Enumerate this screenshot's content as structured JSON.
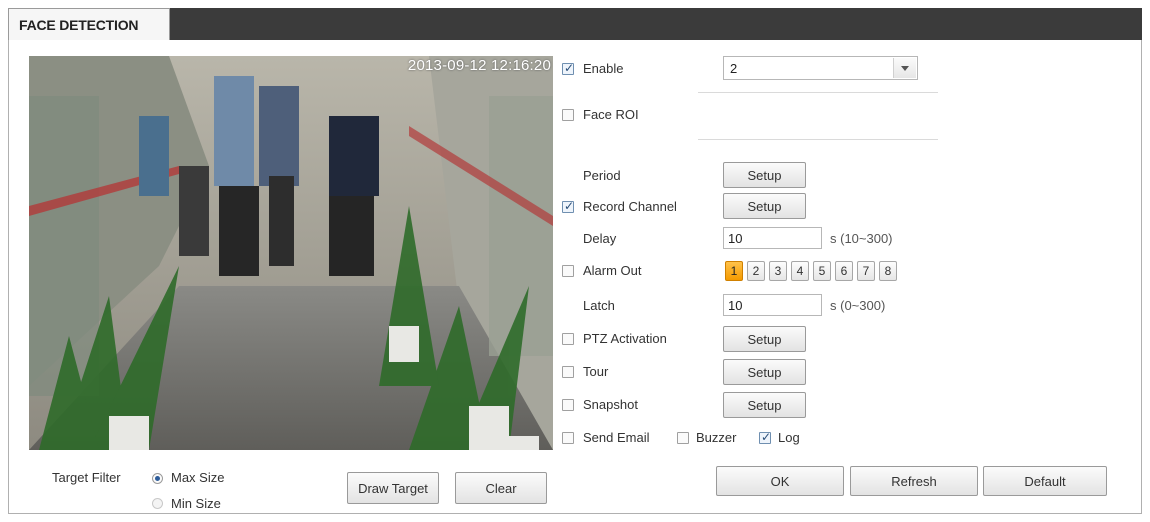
{
  "tab": {
    "title": "FACE DETECTION"
  },
  "video": {
    "timestamp": "2013-09-12 12:16:20"
  },
  "settings": {
    "enable": {
      "label": "Enable",
      "checked": true
    },
    "channel_select": {
      "value": "2"
    },
    "face_roi": {
      "label": "Face ROI",
      "checked": false
    },
    "period": {
      "label": "Period",
      "button": "Setup"
    },
    "record_channel": {
      "label": "Record Channel",
      "checked": true,
      "button": "Setup"
    },
    "delay": {
      "label": "Delay",
      "value": "10",
      "unit": "s (10~300)"
    },
    "alarm_out": {
      "label": "Alarm Out",
      "checked": false,
      "channels": [
        "1",
        "2",
        "3",
        "4",
        "5",
        "6",
        "7",
        "8"
      ],
      "active": "1"
    },
    "latch": {
      "label": "Latch",
      "value": "10",
      "unit": "s (0~300)"
    },
    "ptz_activation": {
      "label": "PTZ Activation",
      "checked": false,
      "button": "Setup"
    },
    "tour": {
      "label": "Tour",
      "checked": false,
      "button": "Setup"
    },
    "snapshot": {
      "label": "Snapshot",
      "checked": false,
      "button": "Setup"
    },
    "send_email": {
      "label": "Send Email",
      "checked": false
    },
    "buzzer": {
      "label": "Buzzer",
      "checked": false
    },
    "log": {
      "label": "Log",
      "checked": true
    }
  },
  "target_filter": {
    "label": "Target Filter",
    "options": [
      {
        "label": "Max Size",
        "checked": true
      },
      {
        "label": "Min Size",
        "checked": false
      }
    ]
  },
  "buttons": {
    "draw_target": "Draw Target",
    "clear": "Clear",
    "ok": "OK",
    "refresh": "Refresh",
    "default": "Default"
  },
  "colors": {
    "header_bar": "#3b3b3b",
    "active_channel": "#f49a00"
  }
}
